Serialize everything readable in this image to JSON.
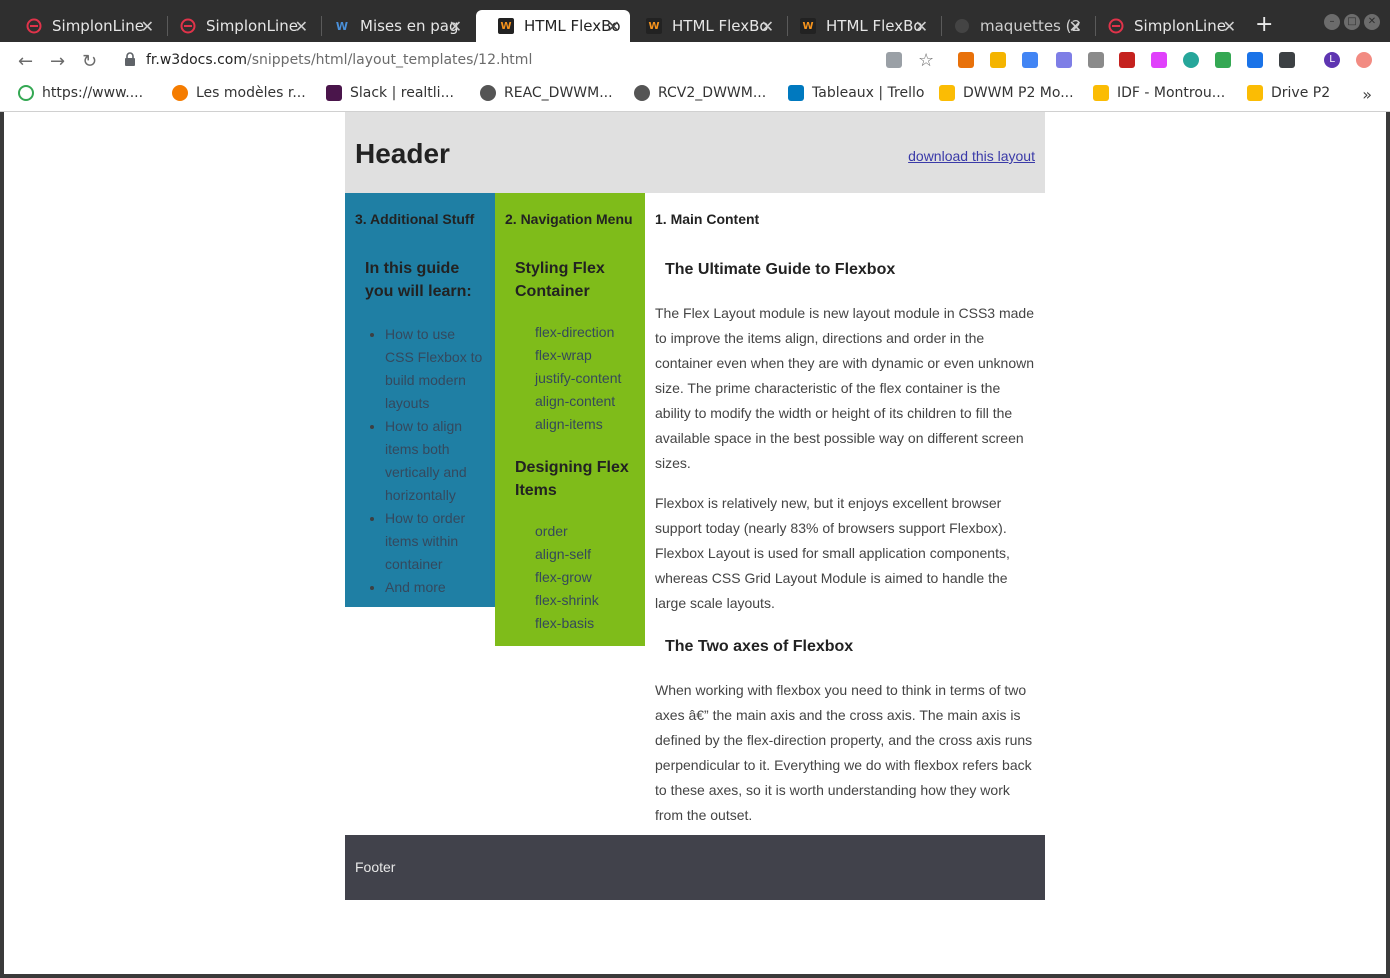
{
  "tabs": [
    {
      "label": "SimplonLine",
      "active": false
    },
    {
      "label": "SimplonLine",
      "active": false
    },
    {
      "label": "Mises en pag",
      "active": false
    },
    {
      "label": "HTML FlexBo",
      "active": true
    },
    {
      "label": "HTML FlexBo",
      "active": false
    },
    {
      "label": "HTML FlexBo",
      "active": false
    },
    {
      "label": "maquettes (2",
      "active": false
    },
    {
      "label": "SimplonLine",
      "active": false
    }
  ],
  "address": {
    "host": "fr.w3docs.com",
    "path": "/snippets/html/layout_templates/12.html"
  },
  "bookmarks": [
    {
      "label": "https://www...."
    },
    {
      "label": "Les modèles r..."
    },
    {
      "label": "Slack | realtli..."
    },
    {
      "label": "REAC_DWWM..."
    },
    {
      "label": "RCV2_DWWM..."
    },
    {
      "label": "Tableaux | Trello"
    },
    {
      "label": "DWWM P2 Mo..."
    },
    {
      "label": "IDF - Montrou..."
    },
    {
      "label": "Drive P2"
    }
  ],
  "profile_initial": "L",
  "header": {
    "title": "Header",
    "link": "download this layout"
  },
  "aside": {
    "title": "3. Additional Stuff",
    "heading": "In this guide you will learn:",
    "items": [
      "How to use CSS Flexbox to build modern layouts",
      "How to align items both vertically and horizontally",
      "How to order items within container",
      "And more"
    ]
  },
  "nav": {
    "title": "2. Navigation Menu",
    "section1": {
      "heading": "Styling Flex Container",
      "items": [
        "flex-direction",
        "flex-wrap",
        "justify-content",
        "align-content",
        "align-items"
      ]
    },
    "section2": {
      "heading": "Designing Flex Items",
      "items": [
        "order",
        "align-self",
        "flex-grow",
        "flex-shrink",
        "flex-basis"
      ]
    }
  },
  "main": {
    "title": "1. Main Content",
    "h1": "The Ultimate Guide to Flexbox",
    "p1": "The Flex Layout module is new layout module in CSS3 made to improve the items align, directions and order in the container even when they are with dynamic or even unknown size. The prime characteristic of the flex container is the ability to modify the width or height of its children to fill the available space in the best possible way on different screen sizes.",
    "p2": "Flexbox is relatively new, but it enjoys excellent browser support today (nearly 83% of browsers support Flexbox). Flexbox Layout is used for small application components, whereas CSS Grid Layout Module is aimed to handle the large scale layouts.",
    "h2": "The Two axes of Flexbox",
    "p3": "When working with flexbox you need to think in terms of two axes â€” the main axis and the cross axis. The main axis is defined by the flex-direction property, and the cross axis runs perpendicular to it. Everything we do with flexbox refers back to these axes, so it is worth understanding how they work from the outset."
  },
  "footer": {
    "label": "Footer"
  },
  "colors": {
    "aside": "#1f7fa4",
    "nav": "#7fbc1a",
    "header": "#e0e0e0",
    "footer": "#41424b"
  }
}
